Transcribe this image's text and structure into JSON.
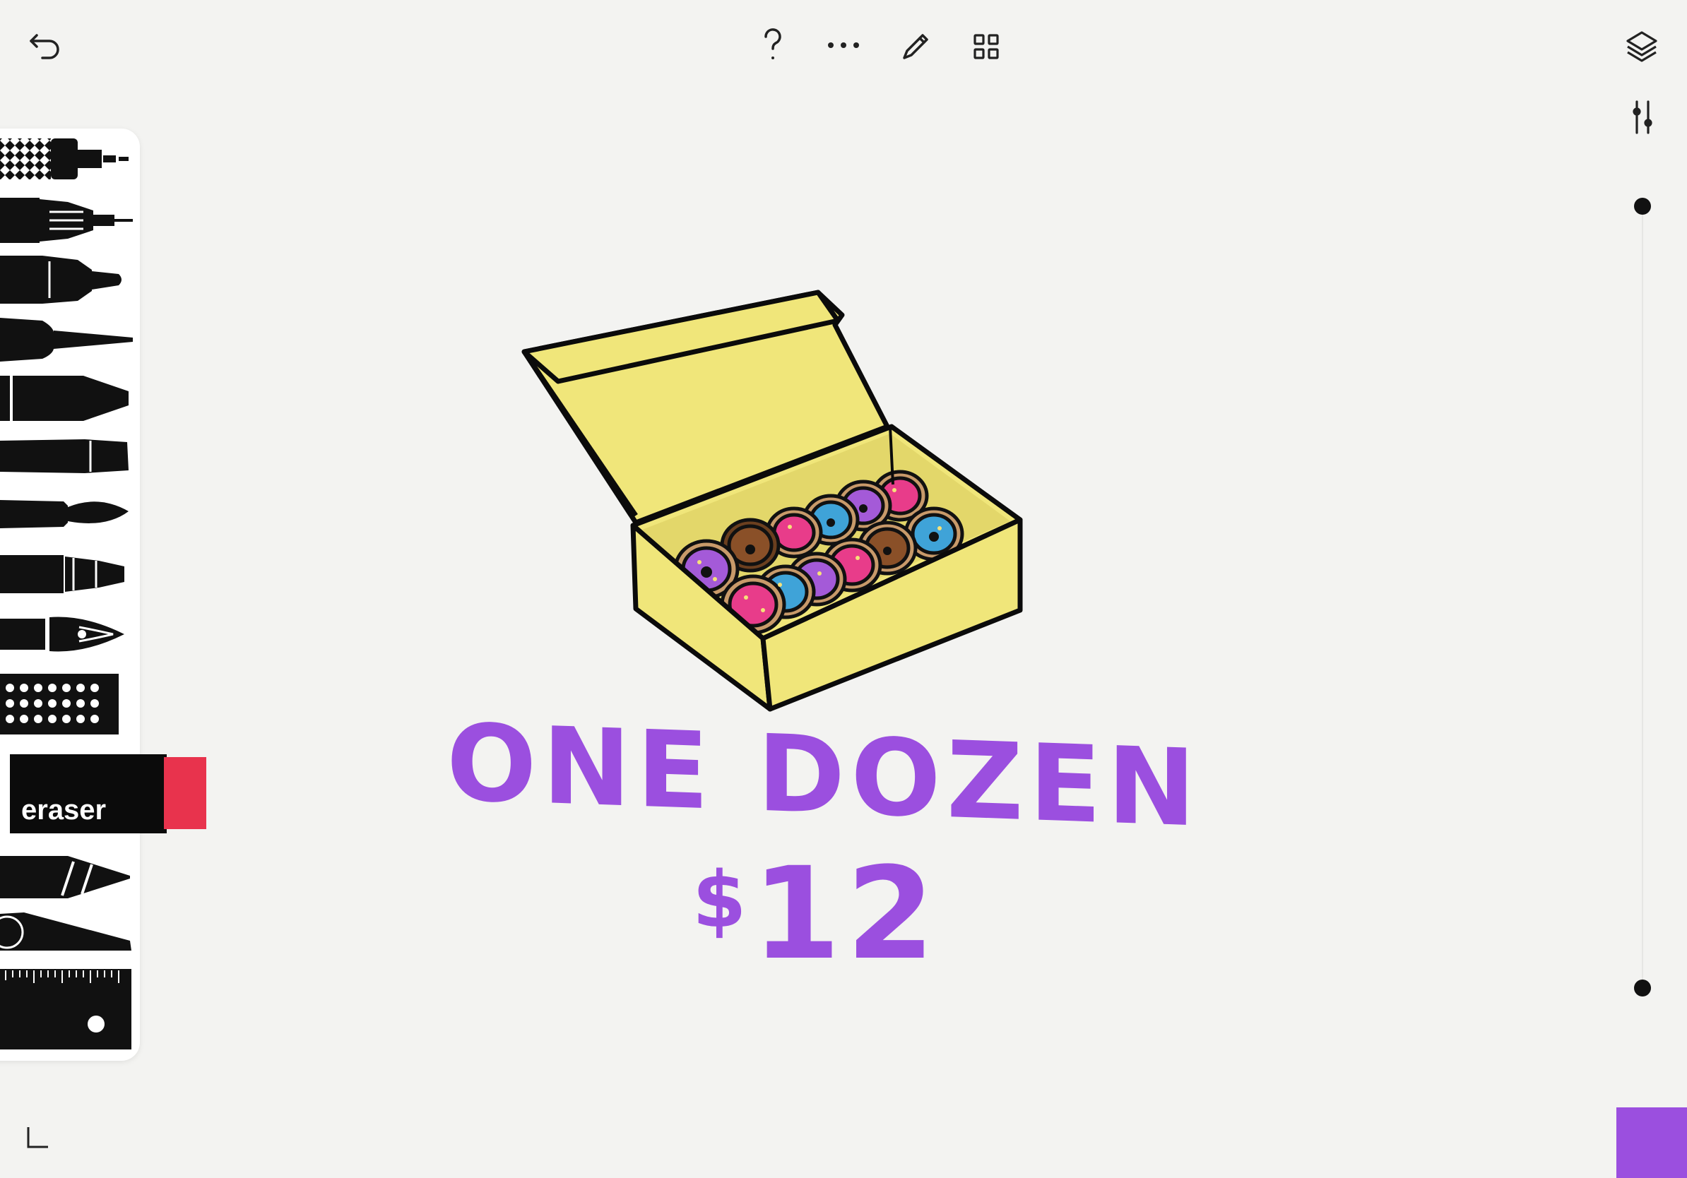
{
  "toolbar": {
    "back_icon": "undo-arrow-icon",
    "help_icon": "question-mark-icon",
    "more_icon": "ellipsis-icon",
    "edit_icon": "pencil-icon",
    "grid_icon": "grid-icon",
    "layers_icon": "layers-icon",
    "adjust_icon": "sliders-icon"
  },
  "tools": {
    "items": [
      "stipple-pen",
      "technical-pen",
      "marker",
      "fine-liner",
      "chisel-marker",
      "brush-pen",
      "paint-brush",
      "felt-pen",
      "fountain-pen",
      "dot-pattern",
      "eraser",
      "pencil",
      "wedge",
      "ruler"
    ],
    "eraser_label": "eraser"
  },
  "artwork": {
    "title": "ONE DOZEN",
    "price_symbol": "$",
    "price_value": "12"
  },
  "colors": {
    "current": "#9b4fdf",
    "box": "#f0e67a",
    "eraser_tip": "#e8334d"
  },
  "corner_icon": "crop-corner-icon"
}
